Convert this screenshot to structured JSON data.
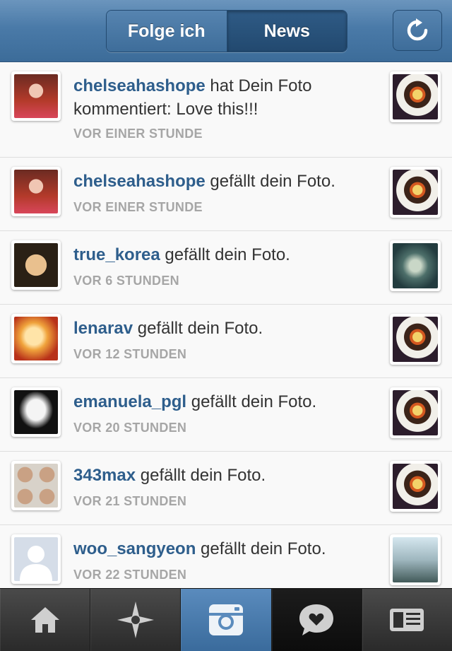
{
  "header": {
    "tab_following": "Folge ich",
    "tab_news": "News",
    "refresh_icon": "refresh-icon"
  },
  "feed": [
    {
      "user": "chelseahashope",
      "text": "hat Dein Foto kommentiert: Love this!!!",
      "time": "VOR EINER STUNDE"
    },
    {
      "user": "chelseahashope",
      "text": "gefällt dein Foto.",
      "time": "VOR EINER STUNDE"
    },
    {
      "user": "true_korea",
      "text": "gefällt dein Foto.",
      "time": "VOR 6 STUNDEN"
    },
    {
      "user": "lenarav",
      "text": "gefällt dein Foto.",
      "time": "VOR 12 STUNDEN"
    },
    {
      "user": "emanuela_pgl",
      "text": "gefällt dein Foto.",
      "time": "VOR 20 STUNDEN"
    },
    {
      "user": "343max",
      "text": "gefällt dein Foto.",
      "time": "VOR 21 STUNDEN"
    },
    {
      "user": "woo_sangyeon",
      "text": "gefällt dein Foto.",
      "time": "VOR 22 STUNDEN"
    }
  ],
  "tabbar": {
    "icons": [
      "home-icon",
      "explore-icon",
      "camera-icon",
      "news-icon",
      "profile-icon"
    ],
    "active": "camera-icon",
    "accent": "#3d6d9b"
  }
}
